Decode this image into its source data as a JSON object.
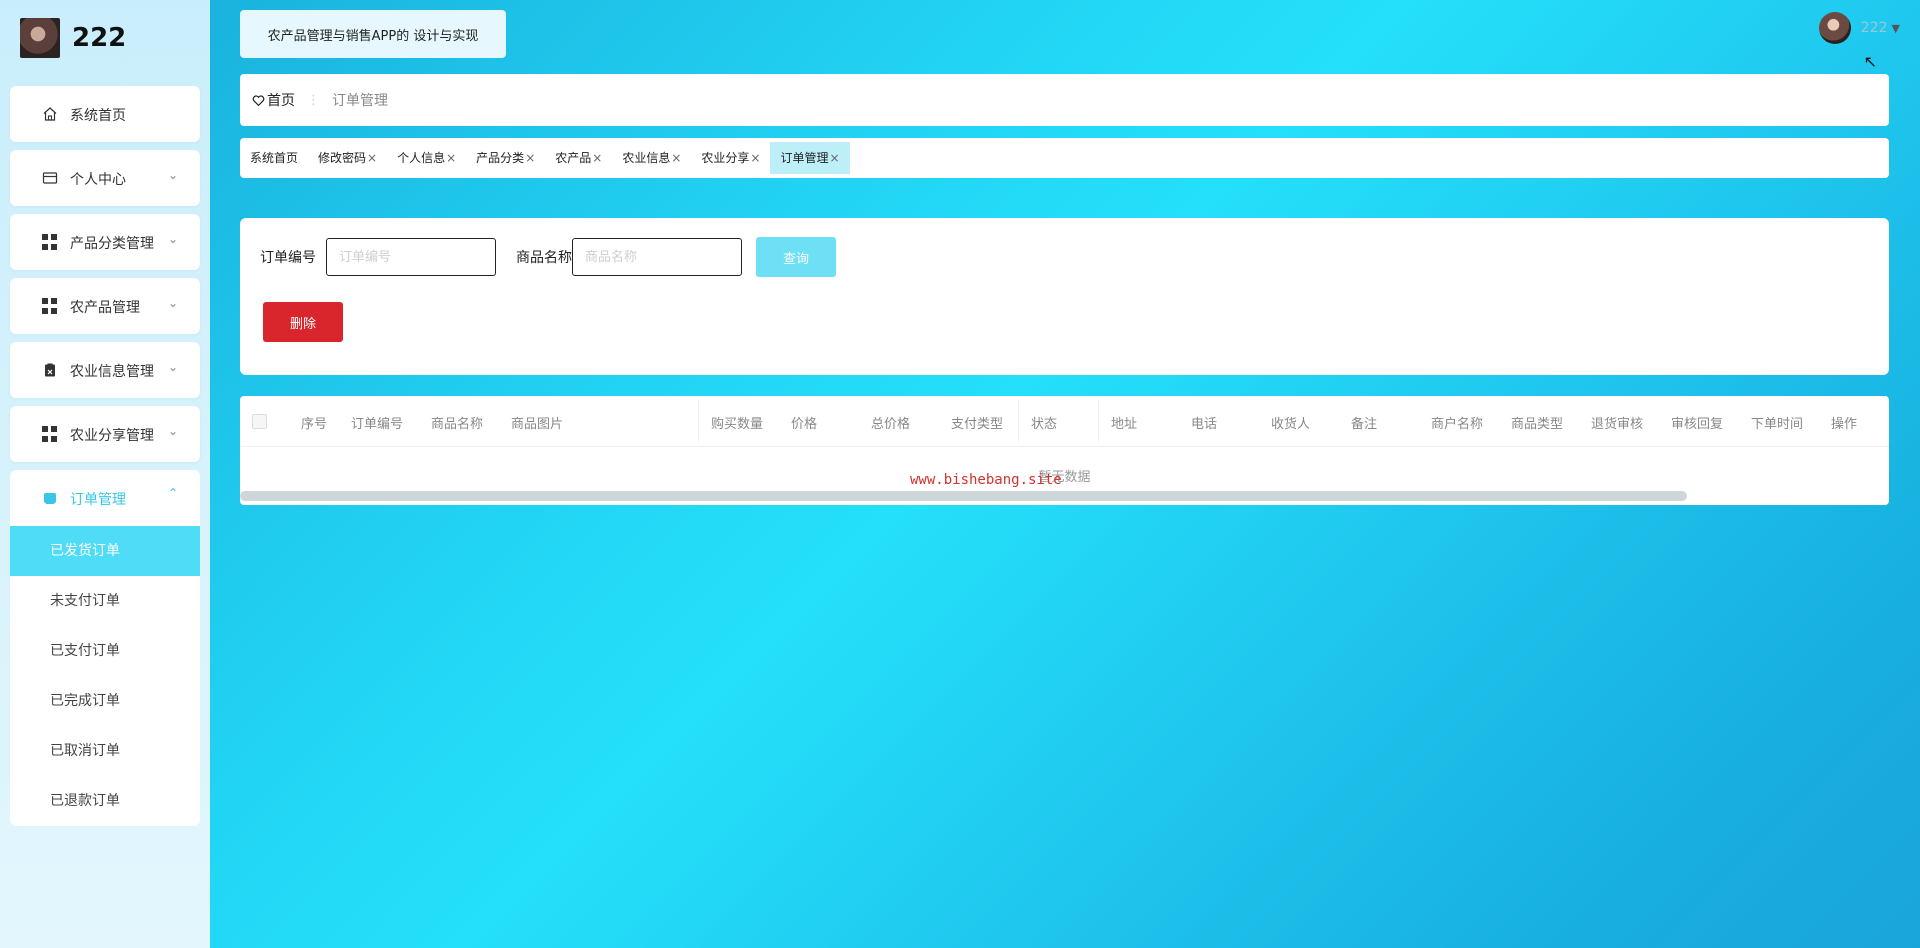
{
  "sidebar": {
    "username": "222",
    "items": [
      {
        "label": "系统首页",
        "icon": "home-icon"
      },
      {
        "label": "个人中心",
        "icon": "card-icon"
      },
      {
        "label": "产品分类管理",
        "icon": "grid-icon"
      },
      {
        "label": "农产品管理",
        "icon": "grid-icon"
      },
      {
        "label": "农业信息管理",
        "icon": "clipboard-icon"
      },
      {
        "label": "农业分享管理",
        "icon": "grid-icon"
      }
    ],
    "open_group": {
      "label": "订单管理",
      "icon": "order-icon",
      "children": [
        "已发货订单",
        "未支付订单",
        "已支付订单",
        "已完成订单",
        "已取消订单",
        "已退款订单"
      ],
      "active_index": 0
    }
  },
  "header": {
    "title": "农产品管理与销售APP的 设计与实现",
    "user_name": "222"
  },
  "breadcrumb": {
    "home": "首页",
    "current": "订单管理"
  },
  "tabs": [
    {
      "label": "系统首页",
      "closable": false
    },
    {
      "label": "修改密码",
      "closable": true
    },
    {
      "label": "个人信息",
      "closable": true
    },
    {
      "label": "产品分类",
      "closable": true
    },
    {
      "label": "农产品",
      "closable": true
    },
    {
      "label": "农业信息",
      "closable": true
    },
    {
      "label": "农业分享",
      "closable": true
    },
    {
      "label": "订单管理",
      "closable": true,
      "active": true
    }
  ],
  "search": {
    "order_no_label": "订单编号",
    "order_no_placeholder": "订单编号",
    "order_no_value": "",
    "product_label": "商品名称",
    "product_placeholder": "商品名称",
    "product_value": "",
    "query_button": "查询",
    "delete_button": "删除"
  },
  "table": {
    "columns": [
      "序号",
      "订单编号",
      "商品名称",
      "商品图片",
      "购买数量",
      "价格",
      "总价格",
      "支付类型",
      "状态",
      "地址",
      "电话",
      "收货人",
      "备注",
      "商户名称",
      "商品类型",
      "退货审核",
      "审核回复",
      "下单时间",
      "操作"
    ],
    "empty_text": "暂无数据",
    "watermark": "www.bishebang.site"
  },
  "colors": {
    "accent": "#39c7e6",
    "active_menu": "#4fdcf7",
    "delete": "#d8262c",
    "query": "#6ee0f5"
  }
}
